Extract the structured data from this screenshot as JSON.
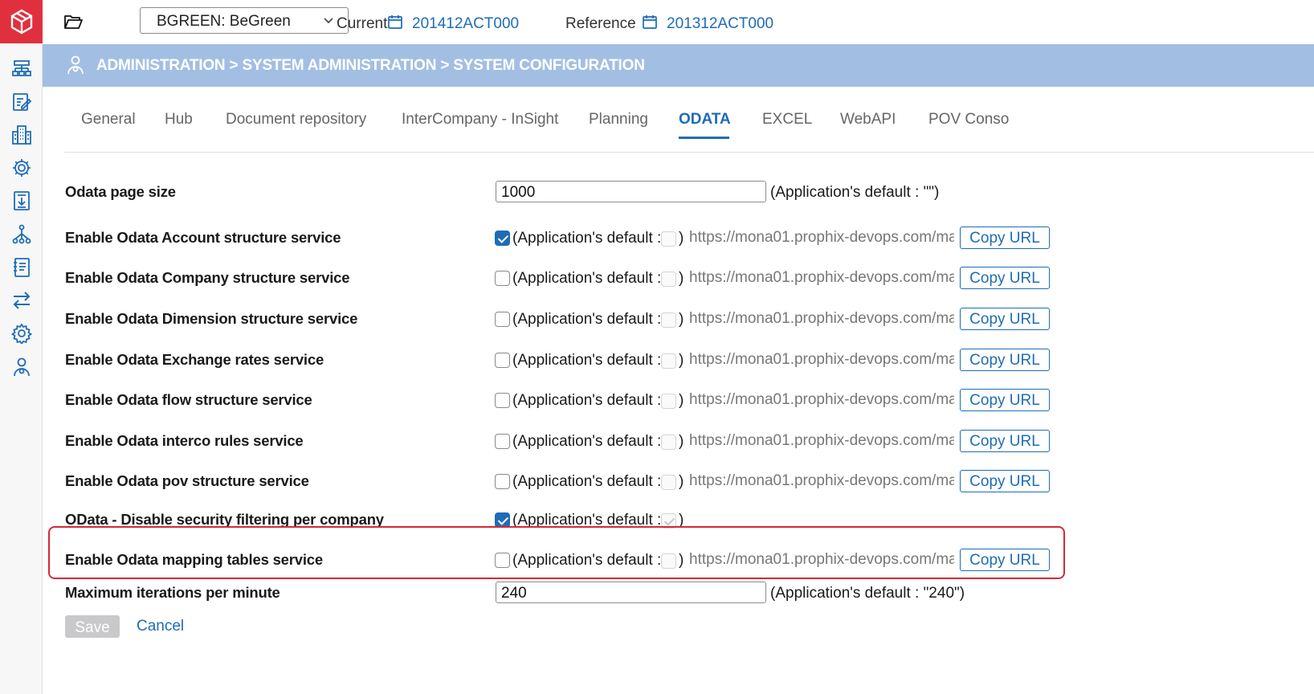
{
  "colors": {
    "brand_red": "#e0303d",
    "accent_blue": "#1f6cb6",
    "banner_blue": "#a2bfe3",
    "highlight_red": "#d42a36"
  },
  "sidebar": {
    "logo": "prophix-logo-icon",
    "items": [
      {
        "icon": "org-chart-icon"
      },
      {
        "icon": "edit-form-icon"
      },
      {
        "icon": "buildings-icon"
      },
      {
        "icon": "settings-gear-icon"
      },
      {
        "icon": "report-download-icon"
      },
      {
        "icon": "hierarchy-icon"
      },
      {
        "icon": "notebook-icon"
      },
      {
        "icon": "exchange-arrows-icon"
      },
      {
        "icon": "configuration-icon"
      },
      {
        "icon": "admin-user-icon"
      }
    ]
  },
  "topbar": {
    "entity_select": "BGREEN: BeGreen",
    "current_label": "Current",
    "current_value": "201412ACT000",
    "reference_label": "Reference",
    "reference_value": "201312ACT000"
  },
  "banner": {
    "title": "ADMINISTRATION > SYSTEM ADMINISTRATION > SYSTEM CONFIGURATION"
  },
  "tabs": [
    {
      "label": "General"
    },
    {
      "label": "Hub"
    },
    {
      "label": "Document repository"
    },
    {
      "label": "InterCompany - InSight"
    },
    {
      "label": "Planning"
    },
    {
      "label": "ODATA",
      "active": true
    },
    {
      "label": "EXCEL"
    },
    {
      "label": "WebAPI"
    },
    {
      "label": "POV Conso"
    }
  ],
  "form": {
    "default_prefix": "(Application's default :",
    "close_paren": ")",
    "url_text": "https://mona01.prophix-devops.com/ma",
    "copy_label": "Copy URL",
    "page_size": {
      "label": "Odata page size",
      "value": "1000",
      "default_text": "(Application's default : \"\")"
    },
    "services": [
      {
        "label": "Enable Odata Account structure service",
        "checked": true,
        "default_checked": false,
        "has_url": true
      },
      {
        "label": "Enable Odata Company structure service",
        "checked": false,
        "default_checked": false,
        "has_url": true
      },
      {
        "label": "Enable Odata Dimension structure service",
        "checked": false,
        "default_checked": false,
        "has_url": true
      },
      {
        "label": "Enable Odata Exchange rates service",
        "checked": false,
        "default_checked": false,
        "has_url": true
      },
      {
        "label": "Enable Odata flow structure service",
        "checked": false,
        "default_checked": false,
        "has_url": true
      },
      {
        "label": "Enable Odata interco rules service",
        "checked": false,
        "default_checked": false,
        "has_url": true
      },
      {
        "label": "Enable Odata pov structure service",
        "checked": false,
        "default_checked": false,
        "has_url": true
      },
      {
        "label": "OData - Disable security filtering per company",
        "checked": true,
        "default_checked": true,
        "has_url": false
      },
      {
        "label": "Enable Odata mapping tables service",
        "checked": false,
        "default_checked": false,
        "has_url": true,
        "highlighted": true
      }
    ],
    "max_iterations": {
      "label": "Maximum iterations per minute",
      "value": "240",
      "default_text": "(Application's default : \"240\")"
    },
    "save_label": "Save",
    "cancel_label": "Cancel"
  }
}
